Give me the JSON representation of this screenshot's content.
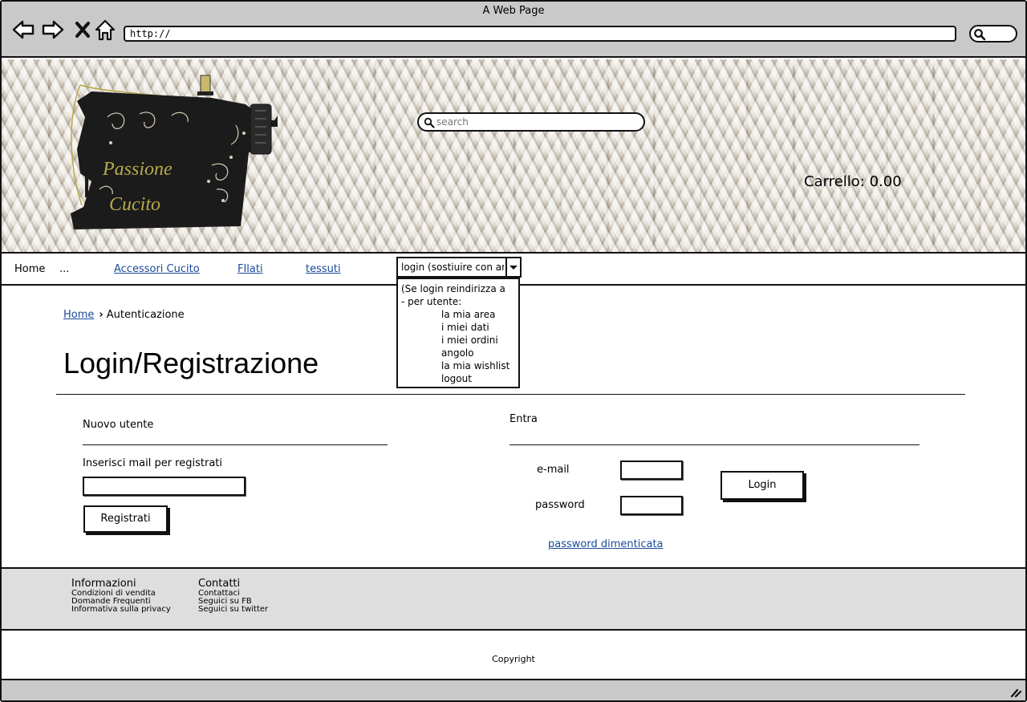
{
  "browser": {
    "title": "A Web Page",
    "url": "http://"
  },
  "header": {
    "logo_text_line1": "Passione",
    "logo_text_line2": "Cucito",
    "search_placeholder": "search",
    "cart": "Carrello: 0.00"
  },
  "nav": {
    "home": "Home",
    "ellipsis": "...",
    "accessori": "Accessori Cucito",
    "filati": "FIlati",
    "tessuti": "tessuti",
    "login_select": "login (sostiuire con area",
    "dropdown": {
      "line1": "(Se login reindirizza a",
      "line2": "- per utente:",
      "items": [
        "la mia area",
        "i miei dati",
        "i miei ordini",
        "angolo",
        "la mia wishlist",
        "logout"
      ]
    }
  },
  "breadcrumb": {
    "home": "Home",
    "current": "Autenticazione"
  },
  "page_title": "Login/Registrazione",
  "register": {
    "heading": "Nuovo utente",
    "label": "Inserisci mail per registrati",
    "button": "Registrati"
  },
  "login": {
    "heading": "Entra",
    "email_label": "e-mail",
    "password_label": "password",
    "button": "Login",
    "forgot": "password dimenticata"
  },
  "footer": {
    "info_heading": "Informazioni",
    "info_items": [
      "Condizioni di vendita",
      "Domande Frequenti",
      "Informativa sulla privacy"
    ],
    "contacts_heading": "Contatti",
    "contacts_items": [
      "Contattaci",
      "Seguici su FB",
      "Seguici su twitter"
    ],
    "copyright": "Copyright"
  }
}
